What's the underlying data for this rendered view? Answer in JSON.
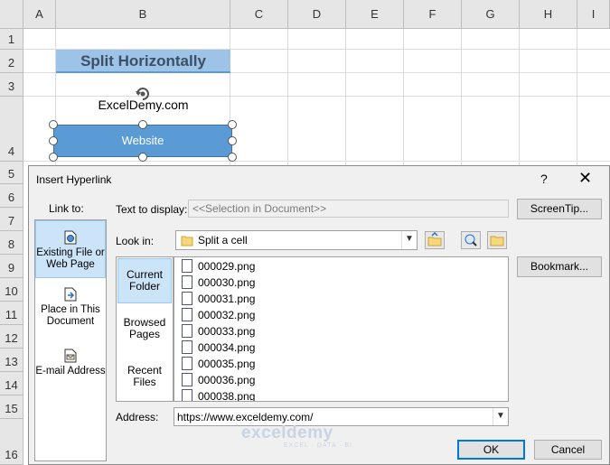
{
  "sheet": {
    "columns": [
      "A",
      "B",
      "C",
      "D",
      "E",
      "F",
      "G",
      "H",
      "I"
    ],
    "rows": [
      "1",
      "2",
      "3",
      "4",
      "5",
      "6",
      "7",
      "8",
      "9",
      "10",
      "11",
      "12",
      "13",
      "14",
      "15",
      "16"
    ],
    "title_cell": "Split Horizontally",
    "text_cell": "ExcelDemy.com",
    "button_shape": "Website"
  },
  "dialog": {
    "title": "Insert Hyperlink",
    "help": "?",
    "close": "✕",
    "link_to_label": "Link to:",
    "link_to_items": [
      {
        "label": "Existing File or Web Page",
        "selected": true
      },
      {
        "label": "Place in This Document"
      },
      {
        "label": "E-mail Address"
      }
    ],
    "text_to_display_label": "Text to display:",
    "text_to_display_value": "<<Selection in Document>>",
    "screentip_button": "ScreenTip...",
    "look_in_label": "Look in:",
    "look_in_value": "Split a cell",
    "side_items": [
      {
        "label": "Current Folder",
        "selected": true
      },
      {
        "label": "Browsed Pages"
      },
      {
        "label": "Recent Files"
      }
    ],
    "files": [
      "000029.png",
      "000030.png",
      "000031.png",
      "000032.png",
      "000033.png",
      "000034.png",
      "000035.png",
      "000036.png",
      "000038.png"
    ],
    "bookmark_button": "Bookmark...",
    "address_label": "Address:",
    "address_value": "https://www.exceldemy.com/",
    "ok_button": "OK",
    "cancel_button": "Cancel"
  },
  "watermark": {
    "name": "exceldemy",
    "tagline": "EXCEL · DATA · BI"
  },
  "colors": {
    "title_fill": "#9dc3e6",
    "shape_fill": "#5b9bd5",
    "selection": "#cce4f7",
    "accent": "#0078d7"
  }
}
